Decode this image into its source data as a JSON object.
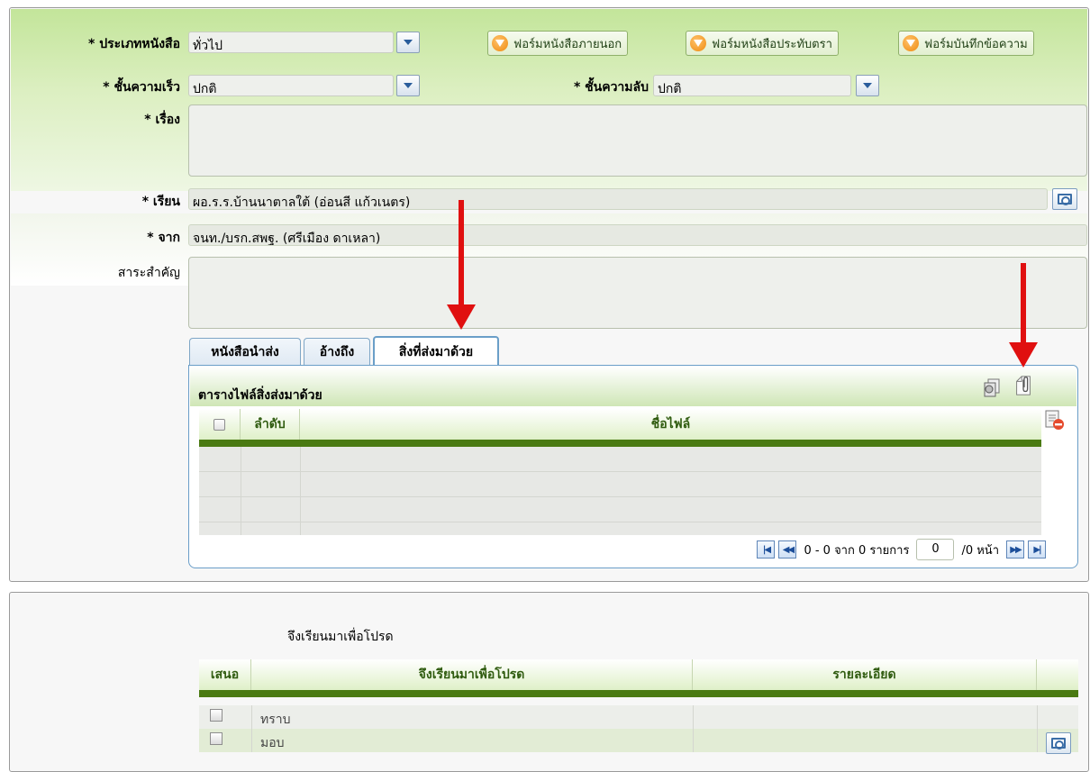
{
  "form": {
    "doc_type_label": "* ประเภทหนังสือ",
    "doc_type_value": "ทั่วไป",
    "speed_label": "* ชั้นความเร็ว",
    "speed_value": "ปกติ",
    "secret_label": "* ชั้นความลับ",
    "secret_value": "ปกติ",
    "subject_label": "* เรื่อง",
    "subject_value": "",
    "to_label": "* เรียน",
    "to_value": "ผอ.ร.ร.บ้านนาตาลใต้ (อ่อนสี แก้วเนตร)",
    "from_label": "* จาก",
    "from_value": "จนท./บรก.สพฐ. (ศรีเมือง ดาเหลา)",
    "summary_label": "สาระสำคัญ",
    "summary_value": ""
  },
  "form_buttons": {
    "external": "ฟอร์มหนังสือภายนอก",
    "stamp": "ฟอร์มหนังสือประทับตรา",
    "memo": "ฟอร์มบันทึกข้อความ"
  },
  "tabs": [
    {
      "label": "หนังสือนำส่ง",
      "active": false
    },
    {
      "label": "อ้างถึง",
      "active": false
    },
    {
      "label": "สิ่งที่ส่งมาด้วย",
      "active": true
    }
  ],
  "attachments": {
    "title": "ตารางไฟล์สิ่งส่งมาด้วย",
    "col_order": "ลำดับ",
    "col_filename": "ชื่อไฟล์",
    "rows": []
  },
  "pager": {
    "range_text": "0 - 0 จาก 0 รายการ",
    "page_value": "0",
    "page_total_text": "/0 หน้า"
  },
  "closing": {
    "heading": "จึงเรียนมาเพื่อโปรด",
    "col_propose": "เสนอ",
    "col_action": "จึงเรียนมาเพื่อโปรด",
    "col_detail": "รายละเอียด",
    "rows": [
      {
        "label": "ทราบ"
      },
      {
        "label": "มอบ"
      }
    ]
  },
  "colors": {
    "accent_green": "#4a7a12",
    "header_green": "#c3e59a",
    "tab_border": "#6a9ec8",
    "annotation_red": "#e01010"
  }
}
